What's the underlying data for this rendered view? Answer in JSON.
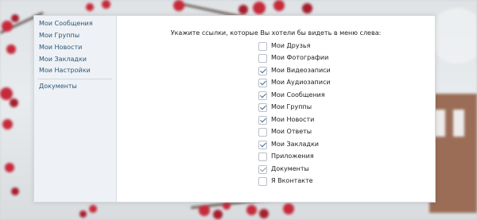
{
  "sidebar": {
    "items": [
      {
        "label": "Мои Сообщения"
      },
      {
        "label": "Мои Группы"
      },
      {
        "label": "Мои Новости"
      },
      {
        "label": "Мои Закладки"
      },
      {
        "label": "Мои Настройки"
      },
      {
        "label": "Документы"
      }
    ]
  },
  "main": {
    "heading": "Укажите ссылки, которые Вы хотели бы видеть в меню слева:",
    "options": [
      {
        "label": "Мои Друзья",
        "checked": false
      },
      {
        "label": "Мои Фотографии",
        "checked": false
      },
      {
        "label": "Мои Видеозаписи",
        "checked": true
      },
      {
        "label": "Мои Аудиозаписи",
        "checked": true
      },
      {
        "label": "Мои Сообщения",
        "checked": true
      },
      {
        "label": "Мои Группы",
        "checked": true
      },
      {
        "label": "Мои Новости",
        "checked": true
      },
      {
        "label": "Мои Ответы",
        "checked": false
      },
      {
        "label": "Мои Закладки",
        "checked": true
      },
      {
        "label": "Приложения",
        "checked": false
      },
      {
        "label": "Документы",
        "checked": true
      },
      {
        "label": "Я Вконтакте",
        "checked": false
      }
    ]
  },
  "colors": {
    "link": "#2b587a",
    "check": "#45688e",
    "sidebar_bg": "#eef1f5"
  }
}
